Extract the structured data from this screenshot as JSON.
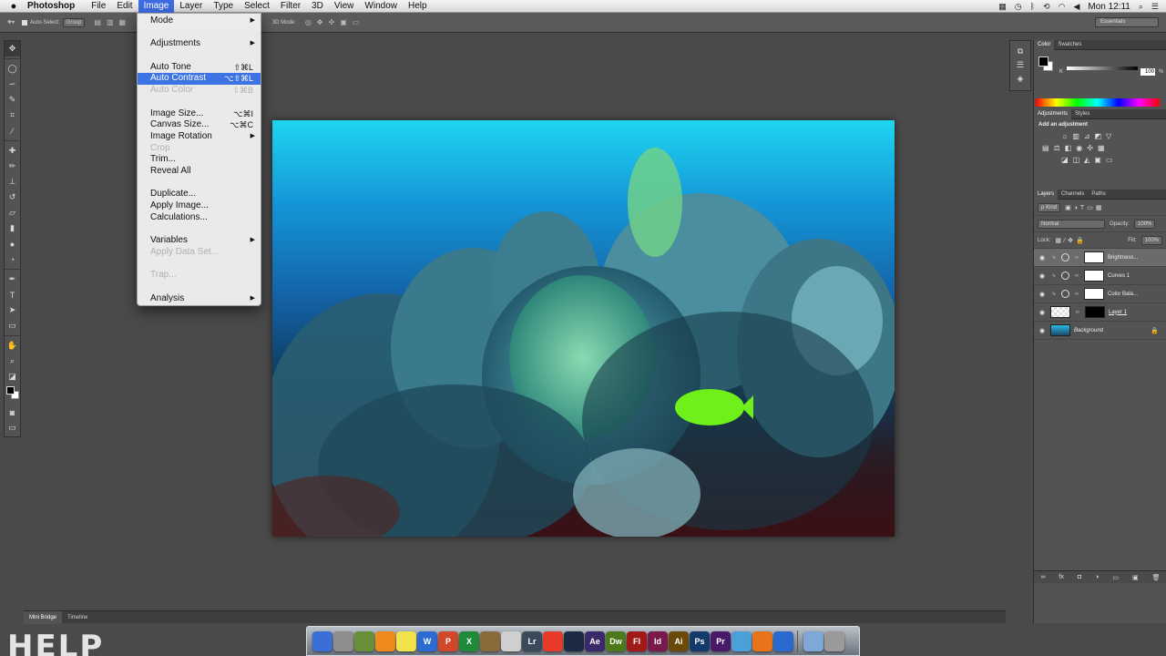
{
  "menubar": {
    "apple_glyph": "",
    "app_name": "Photoshop",
    "items": [
      "File",
      "Edit",
      "Image",
      "Layer",
      "Type",
      "Select",
      "Filter",
      "3D",
      "View",
      "Window",
      "Help"
    ],
    "clock": "Mon 12:11"
  },
  "options": {
    "auto_select": "Auto-Select:",
    "group": "Group",
    "mode_3d": "3D Mode:",
    "workspace": "Essentials"
  },
  "image_menu": [
    {
      "label": "Mode",
      "arrow": true
    },
    {
      "sep": true
    },
    {
      "label": "Adjustments",
      "arrow": true
    },
    {
      "sep": true
    },
    {
      "label": "Auto Tone",
      "shortcut": "⇧⌘L"
    },
    {
      "label": "Auto Contrast",
      "shortcut": "⌥⇧⌘L",
      "highlighted": true
    },
    {
      "label": "Auto Color",
      "shortcut": "⇧⌘B",
      "disabled": true
    },
    {
      "sep": true
    },
    {
      "label": "Image Size...",
      "shortcut": "⌥⌘I"
    },
    {
      "label": "Canvas Size...",
      "shortcut": "⌥⌘C"
    },
    {
      "label": "Image Rotation",
      "arrow": true
    },
    {
      "label": "Crop",
      "disabled": true
    },
    {
      "label": "Trim..."
    },
    {
      "label": "Reveal All"
    },
    {
      "sep": true
    },
    {
      "label": "Duplicate..."
    },
    {
      "label": "Apply Image..."
    },
    {
      "label": "Calculations..."
    },
    {
      "sep": true
    },
    {
      "label": "Variables",
      "arrow": true
    },
    {
      "label": "Apply Data Set...",
      "disabled": true
    },
    {
      "sep": true
    },
    {
      "label": "Trap...",
      "disabled": true
    },
    {
      "sep": true
    },
    {
      "label": "Analysis",
      "arrow": true
    }
  ],
  "bottom_tabs": [
    "Mini Bridge",
    "Timeline"
  ],
  "color_panel": {
    "tabs": [
      "Color",
      "Swatches"
    ],
    "channel": "K",
    "value": "100",
    "unit": "%"
  },
  "adjustments_panel": {
    "tabs": [
      "Adjustments",
      "Styles"
    ],
    "title": "Add an adjustment"
  },
  "layers_panel": {
    "tabs": [
      "Layers",
      "Channels",
      "Paths"
    ],
    "kind": "ρ Kind",
    "blend_mode": "Normal",
    "opacity_label": "Opacity:",
    "opacity": "100%",
    "lock_label": "Lock:",
    "fill_label": "Fill:",
    "fill": "100%",
    "layers": [
      {
        "name": "Brightness...",
        "selected": true,
        "type": "adjustment"
      },
      {
        "name": "Curves 1",
        "type": "adjustment"
      },
      {
        "name": "Color Bala...",
        "type": "adjustment"
      },
      {
        "name": "Layer 1",
        "type": "pixel"
      },
      {
        "name": "Background",
        "type": "background"
      }
    ]
  },
  "dock_apps": [
    {
      "label": "",
      "color": "#3a6fd8",
      "icon": "finder-icon"
    },
    {
      "label": "",
      "color": "#8d8d8d",
      "icon": "launchpad-icon"
    },
    {
      "label": "",
      "color": "#6a8f3a",
      "icon": "finder-sub-icon"
    },
    {
      "label": "",
      "color": "#f08a1c",
      "icon": "vlc-icon"
    },
    {
      "label": "",
      "color": "#f2e24a",
      "icon": "stickies-icon"
    },
    {
      "label": "W",
      "color": "#2c6bd1",
      "icon": "word-icon"
    },
    {
      "label": "P",
      "color": "#d1472c",
      "icon": "powerpoint-icon"
    },
    {
      "label": "X",
      "color": "#1f8a3a",
      "icon": "excel-icon"
    },
    {
      "label": "",
      "color": "#8a6a3a",
      "icon": "photo-icon"
    },
    {
      "label": "",
      "color": "#cfcfcf",
      "icon": "preview-icon"
    },
    {
      "label": "Lr",
      "color": "#3b4a5a",
      "icon": "lightroom-icon"
    },
    {
      "label": "",
      "color": "#e83a2a",
      "icon": "acrobat-icon"
    },
    {
      "label": "",
      "color": "#1c2a44",
      "icon": "cinema-icon"
    },
    {
      "label": "Ae",
      "color": "#3b2a6a",
      "icon": "aftereffects-icon"
    },
    {
      "label": "Dw",
      "color": "#4a7a1a",
      "icon": "dreamweaver-icon"
    },
    {
      "label": "Fl",
      "color": "#a01a1a",
      "icon": "flash-icon"
    },
    {
      "label": "Id",
      "color": "#7a1a4a",
      "icon": "indesign-icon"
    },
    {
      "label": "Ai",
      "color": "#6a4a0a",
      "icon": "illustrator-icon"
    },
    {
      "label": "Ps",
      "color": "#123a6a",
      "icon": "photoshop-icon"
    },
    {
      "label": "Pr",
      "color": "#4a1a6a",
      "icon": "premiere-icon"
    },
    {
      "label": "",
      "color": "#4aa0d8",
      "icon": "safari-icon"
    },
    {
      "label": "",
      "color": "#e8741a",
      "icon": "firefox-icon"
    },
    {
      "label": "",
      "color": "#2a6acf",
      "icon": "chrome-icon"
    },
    {
      "label": "",
      "color": "#7fa8d8",
      "icon": "folder-icon"
    },
    {
      "label": "",
      "color": "#9a9a9a",
      "icon": "trash-icon"
    }
  ],
  "watermark": "HELP"
}
